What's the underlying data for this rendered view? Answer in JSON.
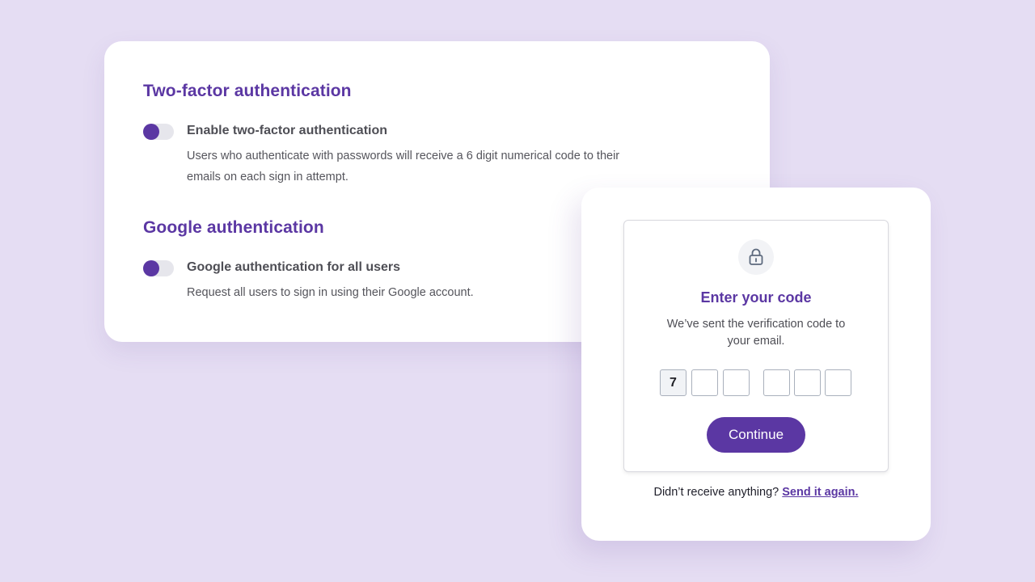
{
  "two_factor": {
    "title": "Two-factor authentication",
    "toggle_label": "Enable two-factor authentication",
    "description_line1": "Users who authenticate with passwords will receive a 6 digit numerical code to their",
    "description_line2": "emails on each sign in attempt."
  },
  "google_auth": {
    "title": "Google authentication",
    "toggle_label": "Google authentication for all users",
    "description": "Request all users to sign in using their Google account."
  },
  "verification": {
    "icon": "lock-icon",
    "title": "Enter your code",
    "subtitle_line1": "We’ve sent the verification code to",
    "subtitle_line2": "your email.",
    "digits": [
      "7",
      "",
      "",
      "",
      "",
      ""
    ],
    "continue_label": "Continue",
    "resend_prompt": "Didn’t receive anything?",
    "resend_link": "Send it again."
  },
  "colors": {
    "background": "#e5ddf3",
    "accent": "#5b37a3",
    "card": "#ffffff"
  }
}
